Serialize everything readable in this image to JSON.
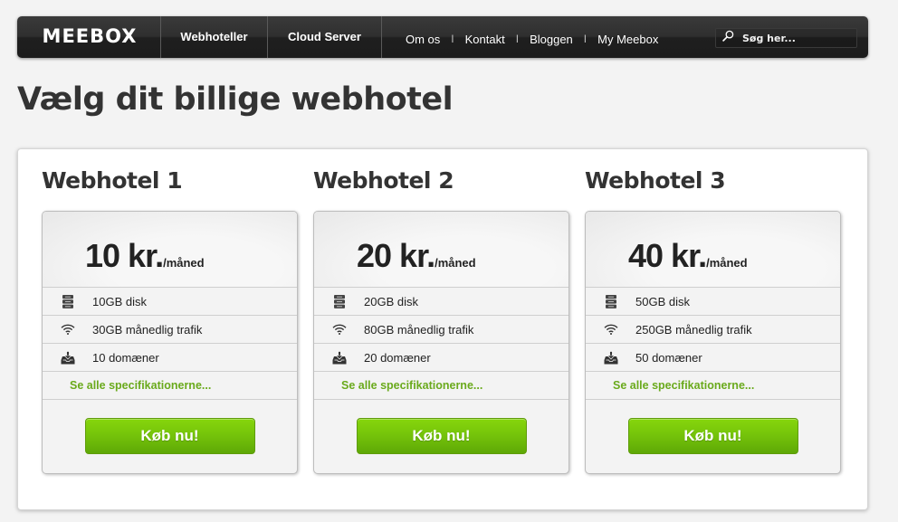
{
  "nav": {
    "logo": "MEEBOX",
    "main_items": [
      "Webhoteller",
      "Cloud Server"
    ],
    "secondary_items": [
      "Om os",
      "Kontakt",
      "Bloggen",
      "My Meebox"
    ],
    "separator": "I",
    "search": {
      "placeholder": "Søg her...",
      "value": "",
      "icon": "search-icon"
    }
  },
  "page": {
    "title": "Vælg dit billige webhotel"
  },
  "plans": [
    {
      "name": "Webhotel 1",
      "price": "10 kr.",
      "unit": "/måned",
      "features": [
        {
          "icon": "server-icon",
          "text": "10GB disk"
        },
        {
          "icon": "wifi-icon",
          "text": "30GB månedlig trafik"
        },
        {
          "icon": "inbox-download-icon",
          "text": "10 domæner"
        }
      ],
      "spec_link": "Se alle specifikationerne...",
      "buy_label": "Køb nu!"
    },
    {
      "name": "Webhotel 2",
      "price": "20 kr.",
      "unit": "/måned",
      "features": [
        {
          "icon": "server-icon",
          "text": "20GB disk"
        },
        {
          "icon": "wifi-icon",
          "text": "80GB månedlig trafik"
        },
        {
          "icon": "inbox-download-icon",
          "text": "20 domæner"
        }
      ],
      "spec_link": "Se alle specifikationerne...",
      "buy_label": "Køb nu!"
    },
    {
      "name": "Webhotel 3",
      "price": "40 kr.",
      "unit": "/måned",
      "features": [
        {
          "icon": "server-icon",
          "text": "50GB disk"
        },
        {
          "icon": "wifi-icon",
          "text": "250GB månedlig trafik"
        },
        {
          "icon": "inbox-download-icon",
          "text": "50 domæner"
        }
      ],
      "spec_link": "Se alle specifikationerne...",
      "buy_label": "Køb nu!"
    }
  ],
  "colors": {
    "accent_green": "#74c20a",
    "link_green": "#6aaa1c",
    "nav_dark": "#1f1f1f"
  }
}
